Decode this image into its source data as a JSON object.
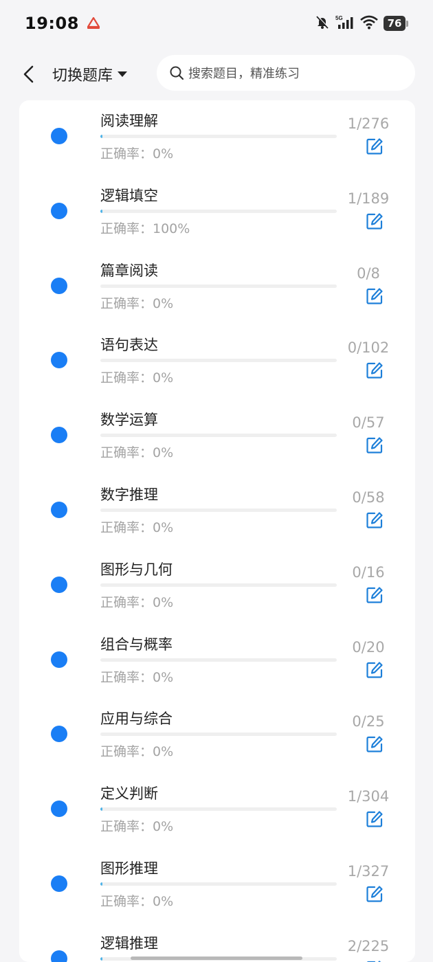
{
  "status_bar": {
    "time": "19:08",
    "battery": "76",
    "icons": [
      "app-logo-icon",
      "bell-muted-icon",
      "5g-signal-icon",
      "wifi-icon",
      "battery-icon"
    ]
  },
  "header": {
    "switch_label": "切换题库",
    "search_placeholder": "搜索题目，精准练习"
  },
  "colors": {
    "accent": "#1a7ef5",
    "progress": "#4fb3e8",
    "muted": "#a3a3a3"
  },
  "items": [
    {
      "title": "阅读理解",
      "accuracy": "正确率：0%",
      "count": "1/276",
      "progress": 0.004
    },
    {
      "title": "逻辑填空",
      "accuracy": "正确率：100%",
      "count": "1/189",
      "progress": 0.005
    },
    {
      "title": "篇章阅读",
      "accuracy": "正确率：0%",
      "count": "0/8",
      "progress": 0
    },
    {
      "title": "语句表达",
      "accuracy": "正确率：0%",
      "count": "0/102",
      "progress": 0
    },
    {
      "title": "数学运算",
      "accuracy": "正确率：0%",
      "count": "0/57",
      "progress": 0
    },
    {
      "title": "数字推理",
      "accuracy": "正确率：0%",
      "count": "0/58",
      "progress": 0
    },
    {
      "title": "图形与几何",
      "accuracy": "正确率：0%",
      "count": "0/16",
      "progress": 0
    },
    {
      "title": "组合与概率",
      "accuracy": "正确率：0%",
      "count": "0/20",
      "progress": 0
    },
    {
      "title": "应用与综合",
      "accuracy": "正确率：0%",
      "count": "0/25",
      "progress": 0
    },
    {
      "title": "定义判断",
      "accuracy": "正确率：0%",
      "count": "1/304",
      "progress": 0.003
    },
    {
      "title": "图形推理",
      "accuracy": "正确率：0%",
      "count": "1/327",
      "progress": 0.003
    },
    {
      "title": "逻辑推理",
      "accuracy": "",
      "count": "2/225",
      "progress": 0.009
    }
  ]
}
